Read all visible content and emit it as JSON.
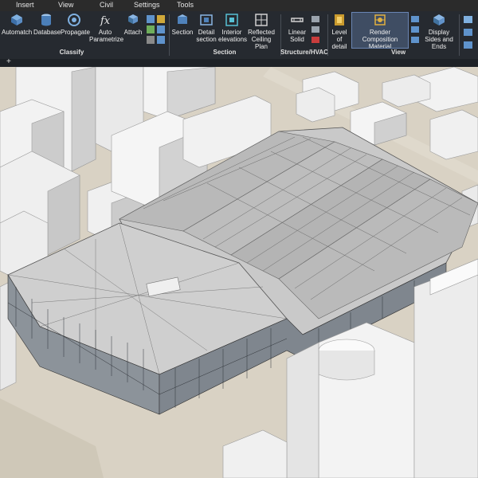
{
  "menu": {
    "items": [
      "Insert",
      "View",
      "Civil",
      "Settings",
      "Tools"
    ]
  },
  "ribbon": {
    "buttons": [
      {
        "label": "Automatch"
      },
      {
        "label": "Database"
      },
      {
        "label": "Propagate"
      },
      {
        "label": "Auto Parametrize"
      },
      {
        "label": "Attach"
      },
      {
        "label": "Section"
      },
      {
        "label": "Detail section"
      },
      {
        "label": "Interior elevations"
      },
      {
        "label": "Reflected Ceiling Plan"
      },
      {
        "label": "Linear Solid"
      },
      {
        "label": "Level of detail"
      },
      {
        "label": "Render Composition Material"
      },
      {
        "label": "Display Sides and Ends"
      }
    ],
    "groups": [
      "Classify",
      "Section",
      "Structure/HVAC",
      "View"
    ],
    "plus": "+"
  },
  "colors": {
    "ribbon_bg": "#262a30",
    "active_btn": "#3f4d63",
    "ground": "#d9d2c4"
  }
}
